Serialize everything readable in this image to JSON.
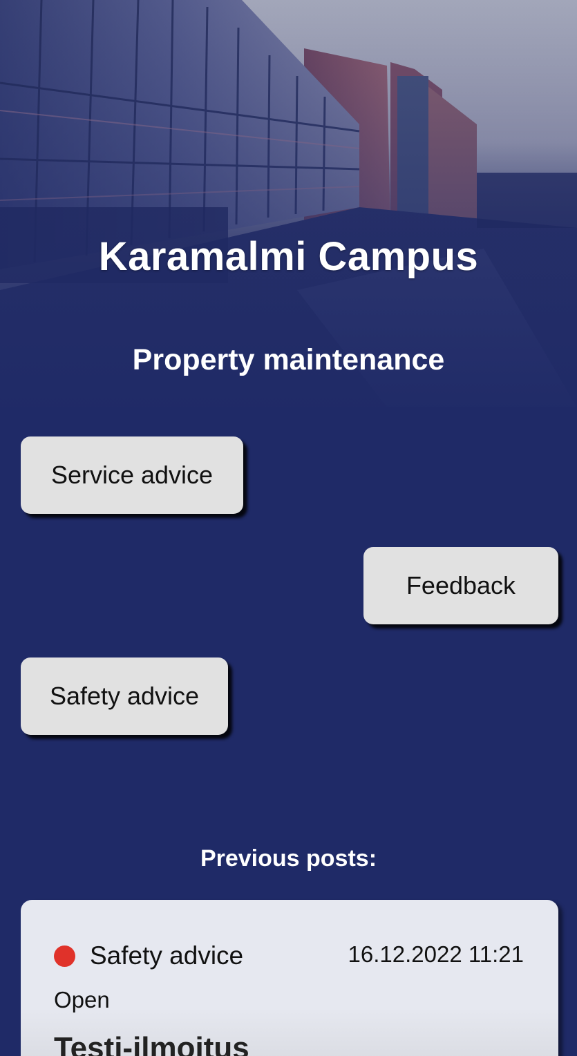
{
  "hero": {
    "title": "Karamalmi Campus",
    "subtitle": "Property maintenance"
  },
  "actions": {
    "service_label": "Service advice",
    "feedback_label": "Feedback",
    "safety_label": "Safety advice"
  },
  "previous_posts": {
    "heading": "Previous posts:",
    "items": [
      {
        "category": "Safety advice",
        "datetime": "16.12.2022 11:21",
        "status": "Open",
        "status_color": "#e0322a",
        "title": "Testi-ilmoitus"
      }
    ]
  },
  "colors": {
    "background": "#1f2a67",
    "button": "#e1e1e1",
    "card": "#e6e8f0",
    "status_open": "#e0322a"
  }
}
